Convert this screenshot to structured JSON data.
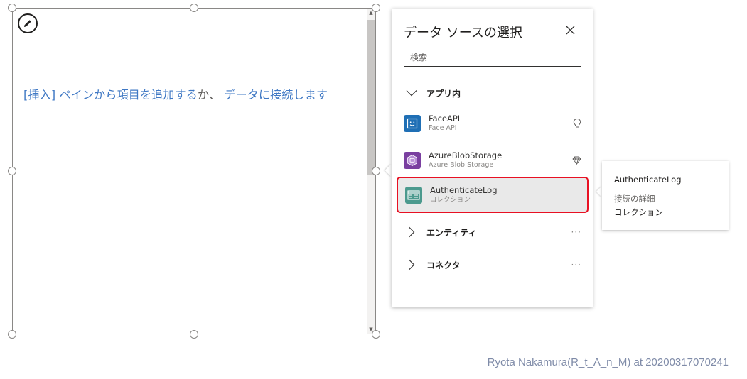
{
  "gallery": {
    "placeholder_insert": "[挿入]",
    "placeholder_pane": " ペインから項目を追加する",
    "placeholder_or": "か、",
    "placeholder_connect": " データに接続します"
  },
  "flyout": {
    "title": "データ ソースの選択",
    "search_placeholder": "検索",
    "groups": [
      {
        "label": "アプリ内",
        "expanded": true
      },
      {
        "label": "エンティティ",
        "expanded": false,
        "more": "···"
      },
      {
        "label": "コネクタ",
        "expanded": false,
        "more": "···"
      }
    ],
    "items": [
      {
        "name": "FaceAPI",
        "subtitle": "Face API",
        "icon": "face-api-icon",
        "trail_icon": "lightbulb-icon",
        "color": "#1f6fb5"
      },
      {
        "name": "AzureBlobStorage",
        "subtitle": "Azure Blob Storage",
        "icon": "azure-blob-storage-icon",
        "trail_icon": "diamond-icon",
        "color": "#7a3fa0"
      },
      {
        "name": "AuthenticateLog",
        "subtitle": "コレクション",
        "icon": "collection-icon",
        "color": "#4c9a8e",
        "selected": true
      }
    ]
  },
  "tooltip": {
    "title": "AuthenticateLog",
    "line1": "接続の詳細",
    "line2": "コレクション"
  },
  "watermark": "Ryota Nakamura(R_t_A_n_M) at 20200317070241",
  "colors": {
    "selection_border": "#e81123",
    "link_text": "#3f78c4"
  }
}
